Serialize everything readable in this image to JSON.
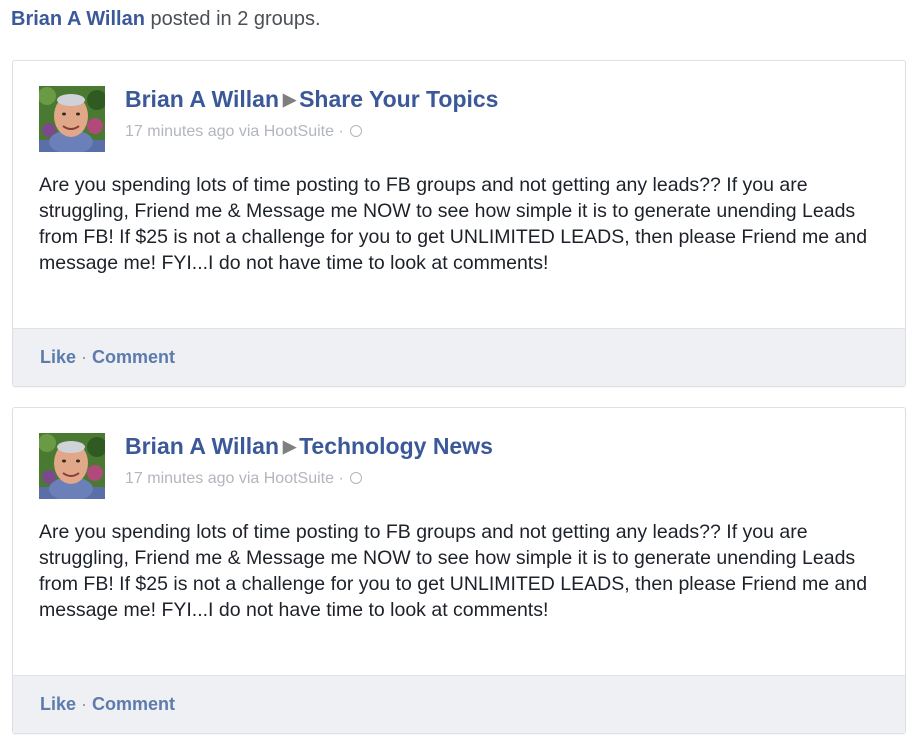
{
  "header": {
    "author": "Brian A Willan",
    "suffix": " posted in 2 groups."
  },
  "posts": [
    {
      "author": "Brian A Willan",
      "group": "Share Your Topics",
      "time": "17 minutes ago",
      "via": " via HootSuite · ",
      "privacy_icon": "globe-icon",
      "body": "Are you spending lots of time posting to FB groups and not getting any leads?? If you are struggling, Friend me & Message me NOW to see how simple it is to generate unending Leads from FB! If $25 is not a challenge for you to get UNLIMITED LEADS, then please Friend me and message me! FYI...I do not have time to look at comments!",
      "like_label": "Like",
      "separator": "·",
      "comment_label": "Comment"
    },
    {
      "author": "Brian A Willan",
      "group": "Technology News",
      "time": "17 minutes ago",
      "via": " via HootSuite · ",
      "privacy_icon": "globe-icon",
      "body": "Are you spending lots of time posting to FB groups and not getting any leads?? If you are struggling, Friend me & Message me NOW to see how simple it is to generate unending Leads from FB! If $25 is not a challenge for you to get UNLIMITED LEADS, then please Friend me and message me! FYI...I do not have time to look at comments!",
      "like_label": "Like",
      "separator": "·",
      "comment_label": "Comment"
    }
  ],
  "colors": {
    "link": "#3b5998",
    "footer_bg": "#eef0f4",
    "meta": "#b2b6bd"
  }
}
